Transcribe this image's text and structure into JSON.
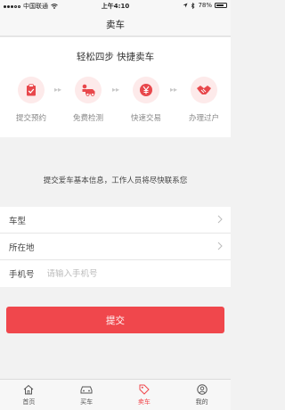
{
  "status_bar": {
    "carrier": "中国联通",
    "time": "上午4:10",
    "battery": "78%",
    "battery_level": 0.78
  },
  "nav": {
    "title": "卖车"
  },
  "steps": {
    "title": "轻松四步 快捷卖车",
    "items": [
      {
        "label": "提交预约",
        "icon": "clipboard-icon"
      },
      {
        "label": "免费检测",
        "icon": "car-inspection-icon"
      },
      {
        "label": "快速交易",
        "icon": "yuan-coin-icon"
      },
      {
        "label": "办理过户",
        "icon": "handshake-icon"
      }
    ]
  },
  "info_text": "提交爱车基本信息，工作人员将尽快联系您",
  "form": {
    "car_model_label": "车型",
    "location_label": "所在地",
    "phone_label": "手机号",
    "phone_placeholder": "请输入手机号",
    "phone_value": ""
  },
  "submit_label": "提交",
  "tabs": [
    {
      "label": "首页",
      "icon": "home-icon",
      "active": false
    },
    {
      "label": "买车",
      "icon": "car-icon",
      "active": false
    },
    {
      "label": "卖车",
      "icon": "tag-icon",
      "active": true
    },
    {
      "label": "我的",
      "icon": "user-icon",
      "active": false
    }
  ],
  "colors": {
    "accent": "#f0474c",
    "icon_bg": "#fdeaea"
  }
}
